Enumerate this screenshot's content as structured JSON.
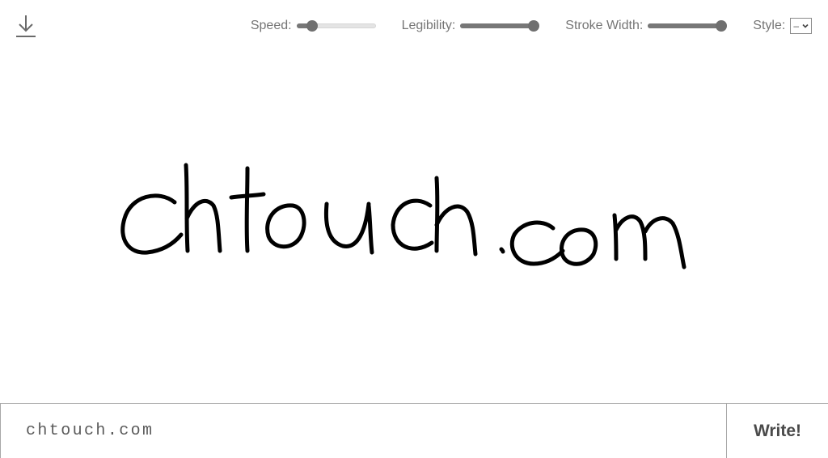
{
  "toolbar": {
    "download_icon": "download-icon",
    "speed": {
      "label": "Speed:",
      "value": 0.15
    },
    "legibility": {
      "label": "Legibility:",
      "value": 1.0
    },
    "stroke_width": {
      "label": "Stroke Width:",
      "value": 1.0
    },
    "style": {
      "label": "Style:",
      "selected": "–",
      "icon": "chevron-down-icon"
    }
  },
  "canvas": {
    "rendered_text": "chtouch.com",
    "stroke_color": "#000000"
  },
  "input": {
    "value": "chtouch.com",
    "placeholder": ""
  },
  "write_button": {
    "label": "Write!"
  }
}
